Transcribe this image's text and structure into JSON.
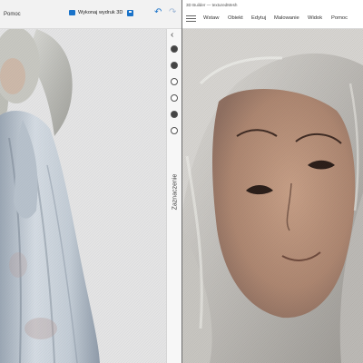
{
  "left_window": {
    "help_menu": "Pomoc",
    "print_button": "Wykonaj wydruk 3D",
    "side_panel_label": "Zaznaczenie"
  },
  "right_window": {
    "title": "3D Builder — texturedMesh",
    "menu": [
      "Wstaw",
      "Obiekt",
      "Edytuj",
      "Malowanie",
      "Widok",
      "Pomoc"
    ]
  },
  "icons": {
    "print": "printer-icon",
    "save": "save-icon",
    "undo": "undo-icon",
    "redo": "redo-icon",
    "collapse": "chevron-left-icon",
    "menu": "hamburger-icon"
  },
  "colors": {
    "accent": "#1a73c9",
    "model_left": "#c9d0d8",
    "skin": "#b88f76"
  }
}
